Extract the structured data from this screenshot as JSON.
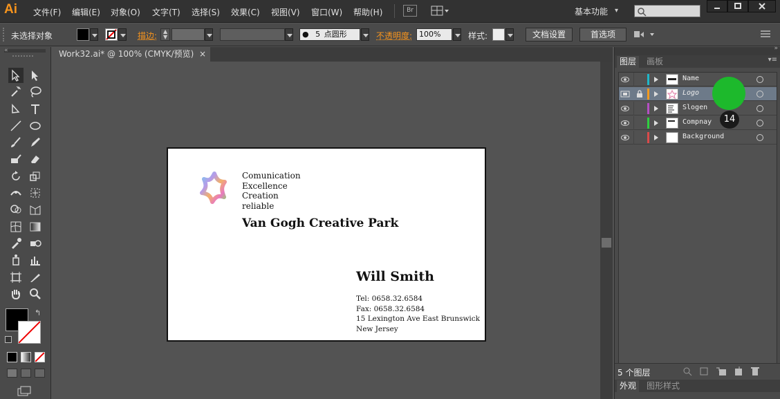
{
  "app": {
    "logo": "Ai"
  },
  "menu": [
    "文件(F)",
    "编辑(E)",
    "对象(O)",
    "文字(T)",
    "选择(S)",
    "效果(C)",
    "视图(V)",
    "窗口(W)",
    "帮助(H)"
  ],
  "bridge_label": "Br",
  "workspace": "基本功能",
  "control": {
    "no_selection": "未选择对象",
    "stroke_label": "描边:",
    "brush_size": "5",
    "brush_shape": "点圆形",
    "opacity_label": "不透明度:",
    "opacity_value": "100%",
    "style_label": "样式:",
    "doc_setup": "文档设置",
    "preferences": "首选项"
  },
  "document_tab": {
    "title": "Work32.ai* @ 100% (CMYK/预览)",
    "close": "×"
  },
  "card": {
    "taglines": [
      "Comunication",
      "Excellence",
      "Creation",
      "reliable"
    ],
    "company": "Van Gogh Creative Park",
    "person": "Will Smith",
    "tel": "Tel: 0658.32.6584",
    "fax": "Fax: 0658.32.6584",
    "address1": "15 Lexington Ave East Brunswick",
    "address2": "New Jersey"
  },
  "layers_panel": {
    "tabs": [
      "图层",
      "画板"
    ],
    "layers": [
      {
        "name": "Name",
        "color": "#1fb6c9"
      },
      {
        "name": "Logo",
        "color": "#f39a1e",
        "selected": true,
        "locked": true
      },
      {
        "name": "Slogen",
        "color": "#b44fc3"
      },
      {
        "name": "Compnay",
        "color": "#2fcf3f"
      },
      {
        "name": "Background",
        "color": "#d94a4a"
      }
    ],
    "count": "5 个图层",
    "bottom_tabs": [
      "外观",
      "图形样式"
    ]
  },
  "click_badge": "14",
  "colors": {
    "accent": "#f7941d",
    "highlight": "#1db92c",
    "selection": "#6d7a89"
  }
}
